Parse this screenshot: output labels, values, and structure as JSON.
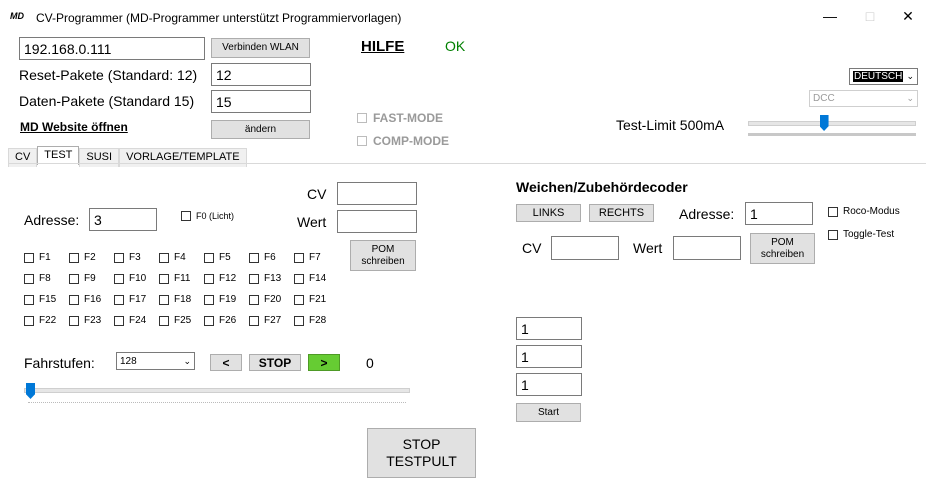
{
  "window": {
    "icon_text": "MD",
    "title": "CV-Programmer (MD-Programmer unterstützt Programmiervorlagen)",
    "minimize": "—",
    "maximize": "□",
    "close": "✕"
  },
  "connection": {
    "ip_value": "192.168.0.111",
    "connect_button": "Verbinden WLAN",
    "help_link": "HILFE",
    "status": "OK",
    "reset_label": "Reset-Pakete (Standard: 12)",
    "reset_value": "12",
    "data_label": "Daten-Pakete (Standard 15)",
    "data_value": "15",
    "website_link": "MD Website öffnen",
    "change_button": "ändern"
  },
  "modes": {
    "fast_mode": "FAST-MODE",
    "comp_mode": "COMP-MODE"
  },
  "settings": {
    "language": "DEUTSCH",
    "protocol": "DCC",
    "test_limit_label": "Test-Limit 500mA",
    "test_limit_fraction": 0.45
  },
  "tabs": [
    "CV",
    "TEST",
    "SUSI",
    "VORLAGE/TEMPLATE"
  ],
  "test": {
    "address_label": "Adresse:",
    "address_value": "3",
    "f0_label": "F0 (Licht)",
    "cv_label": "CV",
    "cv_value": "",
    "wert_label": "Wert",
    "wert_value": "",
    "pom_button": "POM\nschreiben",
    "functions": [
      [
        "F1",
        "F2",
        "F3",
        "F4",
        "F5",
        "F6",
        "F7"
      ],
      [
        "F8",
        "F9",
        "F10",
        "F11",
        "F12",
        "F13",
        "F14"
      ],
      [
        "F15",
        "F16",
        "F17",
        "F18",
        "F19",
        "F20",
        "F21"
      ],
      [
        "F22",
        "F23",
        "F24",
        "F25",
        "F26",
        "F27",
        "F28"
      ]
    ],
    "fahrstufen_label": "Fahrstufen:",
    "fahrstufen_value": "128",
    "back_button": "<",
    "stop_button": "STOP",
    "forward_button": ">",
    "speed_value": "0",
    "speed_fraction": 0,
    "stop_testpult": "STOP\nTESTPULT"
  },
  "accessory": {
    "title": "Weichen/Zubehördecoder",
    "links_button": "LINKS",
    "rechts_button": "RECHTS",
    "address_label": "Adresse:",
    "address_value": "1",
    "roco_label": "Roco-Modus",
    "toggle_label": "Toggle-Test",
    "cv_label": "CV",
    "cv_value": "",
    "wert_label": "Wert",
    "wert_value": "",
    "pom_button": "POM\nschreiben",
    "field1": "1",
    "field2": "1",
    "field3": "1",
    "start_button": "Start"
  },
  "colors": {
    "status_ok": "#008000",
    "forward_active": "#66cc33",
    "slider_thumb": "#0078d7",
    "language_bg": "#000000"
  }
}
